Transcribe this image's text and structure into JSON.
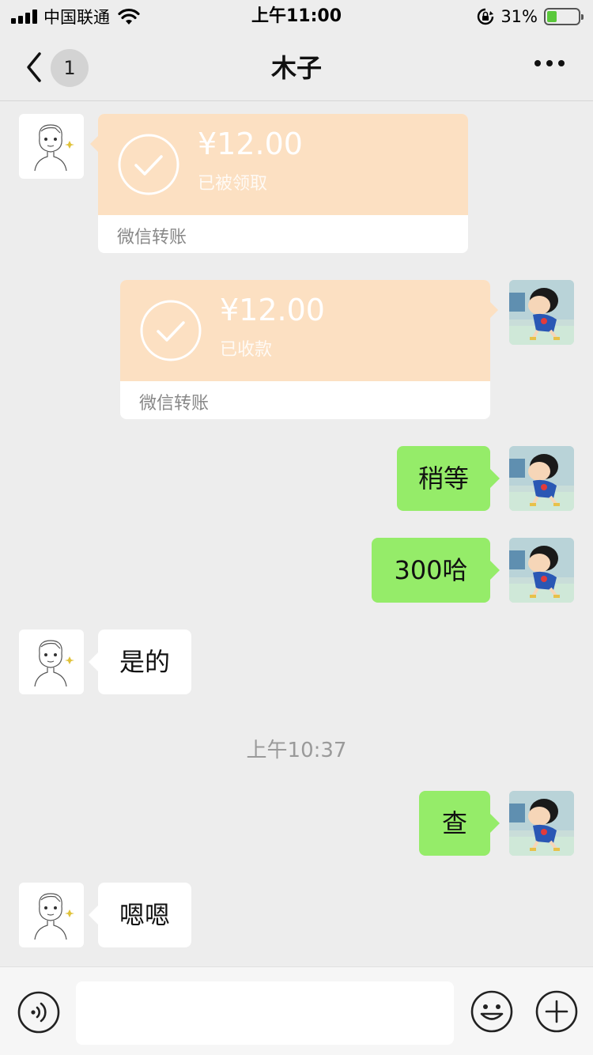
{
  "status_bar": {
    "carrier": "中国联通",
    "time": "上午11:00",
    "battery_percent": "31%",
    "battery_level": 0.31,
    "icons": [
      "signal-icon",
      "wifi-icon",
      "rotation-lock-icon",
      "battery-charging-icon"
    ]
  },
  "nav": {
    "back_badge": "1",
    "title": "木子",
    "more_icon": "more-dots-icon"
  },
  "messages": {
    "transfer_received": {
      "amount": "¥12.00",
      "status": "已被领取",
      "label": "微信转账"
    },
    "transfer_collected": {
      "amount": "¥12.00",
      "status": "已收款",
      "label": "微信转账"
    },
    "msg_wait": "稍等",
    "msg_300": "300哈",
    "msg_yes": "是的",
    "timestamp": "上午10:37",
    "msg_check": "查",
    "msg_en": "嗯嗯"
  },
  "input_bar": {
    "placeholder": "",
    "icons": [
      "voice-icon",
      "emoji-icon",
      "plus-icon"
    ]
  },
  "colors": {
    "background": "#ededed",
    "sent_bubble": "#95ec69",
    "received_bubble": "#ffffff",
    "transfer_card": "#fce0c2"
  }
}
